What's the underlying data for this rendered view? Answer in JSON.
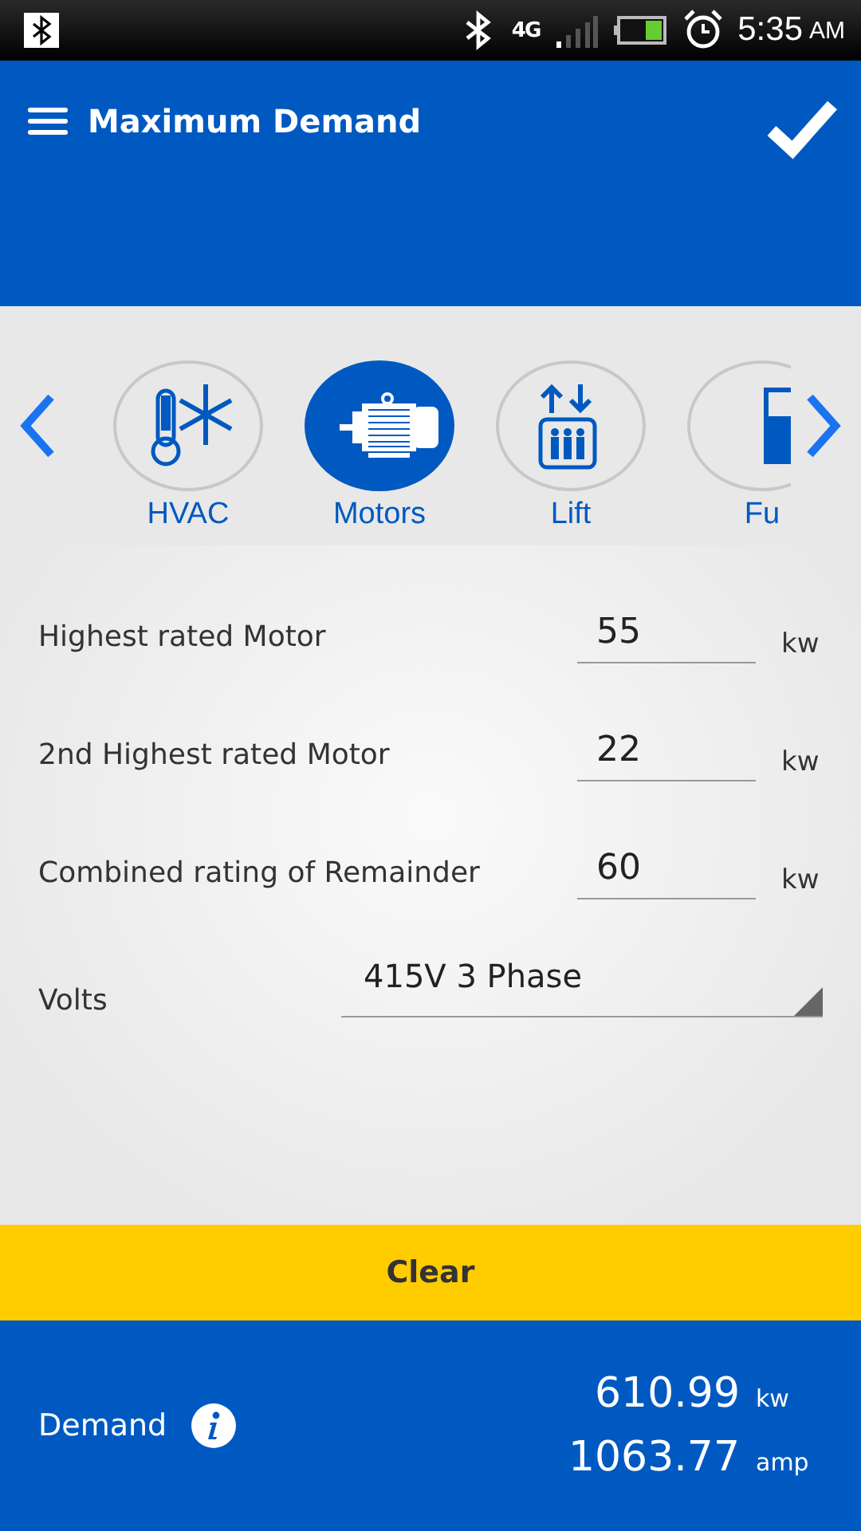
{
  "status_bar": {
    "network": "4G",
    "time": "5:35",
    "meridiem": "AM"
  },
  "header": {
    "title": "Maximum Demand"
  },
  "categories": [
    {
      "label": "HVAC",
      "kind": "hvac",
      "selected": false
    },
    {
      "label": "Motors",
      "kind": "motor",
      "selected": true
    },
    {
      "label": "Lift",
      "kind": "lift",
      "selected": false
    },
    {
      "label": "Fu",
      "kind": "fuel",
      "selected": false
    }
  ],
  "fields": [
    {
      "label": "Highest rated Motor",
      "value": "55",
      "unit": "kw"
    },
    {
      "label": "2nd Highest rated Motor",
      "value": "22",
      "unit": "kw"
    },
    {
      "label": "Combined rating of Remainder",
      "value": "60",
      "unit": "kw"
    }
  ],
  "volts": {
    "label": "Volts",
    "value": "415V 3 Phase"
  },
  "clear_button": "Clear",
  "result": {
    "label": "Demand",
    "power": "610.99",
    "power_unit": "kw",
    "current": "1063.77",
    "current_unit": "amp"
  }
}
